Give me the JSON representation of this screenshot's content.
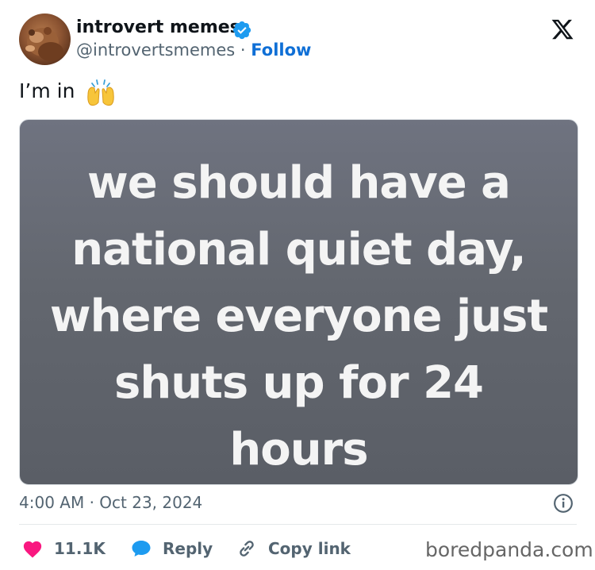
{
  "author": {
    "display_name": "introvert memes",
    "handle": "@introvertsmemes",
    "separator": " · ",
    "follow_label": "Follow",
    "verified": true
  },
  "tweet": {
    "text": "I’m in",
    "emoji": "raising-hands",
    "media_text_lines": [
      "we should have a",
      "national quiet day,",
      "where everyone just",
      "shuts up for 24",
      "hours"
    ],
    "timestamp": "4:00 AM · Oct 23, 2024"
  },
  "actions": {
    "like_count": "11.1K",
    "reply_label": "Reply",
    "copy_link_label": "Copy link"
  },
  "watermark": "boredpanda.com",
  "colors": {
    "follow_blue": "#0f6fd6",
    "like_red": "#f91880",
    "reply_blue": "#1d9bf0",
    "verified_blue": "#1d9bf0",
    "muted_gray": "#536471"
  },
  "icons": [
    "x-logo-icon",
    "verified-badge-icon",
    "info-icon",
    "heart-icon",
    "speech-bubble-icon",
    "link-icon"
  ]
}
